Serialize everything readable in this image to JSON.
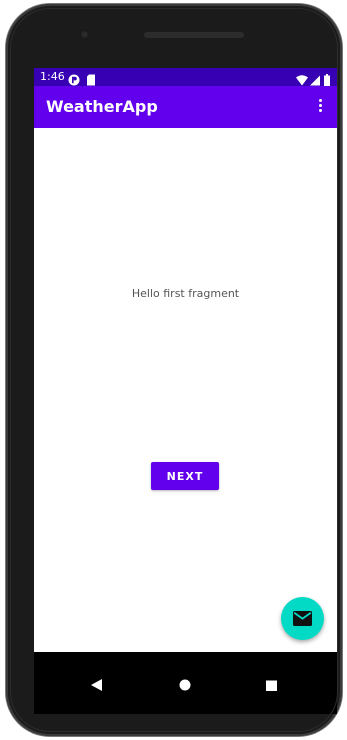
{
  "status_bar": {
    "time": "1:46",
    "icons": [
      "notification-icon",
      "sd-card-icon",
      "wifi-icon",
      "signal-icon",
      "battery-icon"
    ]
  },
  "app_bar": {
    "title": "WeatherApp",
    "overflow_icon": "more-vert-icon"
  },
  "content": {
    "message": "Hello first fragment",
    "next_button_label": "NEXT"
  },
  "fab": {
    "icon": "email-icon"
  },
  "nav_bar": {
    "buttons": [
      "back-icon",
      "home-icon",
      "recents-icon"
    ]
  },
  "colors": {
    "status_bar": "#3700b3",
    "primary": "#6200ee",
    "accent": "#03dac5"
  }
}
